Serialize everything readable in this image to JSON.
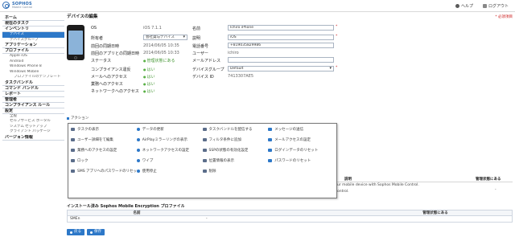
{
  "header": {
    "brand": "SOPHOS",
    "product": "Mobile Control",
    "help": "ヘルプ",
    "logout": "ログアウト"
  },
  "sidebar": {
    "items": [
      {
        "label": "ホーム",
        "kind": "group"
      },
      {
        "label": "現在のタスク",
        "kind": "group"
      },
      {
        "label": "インベントリ",
        "kind": "group"
      },
      {
        "label": "デバイス",
        "kind": "sub",
        "active": true
      },
      {
        "label": "デバイスグループ",
        "kind": "sub"
      },
      {
        "label": "アプリケーション",
        "kind": "group"
      },
      {
        "label": "プロファイル",
        "kind": "group"
      },
      {
        "label": "Apple iOS",
        "kind": "sub"
      },
      {
        "label": "Android",
        "kind": "sub"
      },
      {
        "label": "Windows Phone 8",
        "kind": "sub"
      },
      {
        "label": "Windows Mobile",
        "kind": "sub"
      },
      {
        "label": "プロファイルのテンプレート",
        "kind": "sub2"
      },
      {
        "label": "タスクバンドル",
        "kind": "group"
      },
      {
        "label": "コマンド バンドル",
        "kind": "group"
      },
      {
        "label": "レポート",
        "kind": "group"
      },
      {
        "label": "管理者",
        "kind": "group"
      },
      {
        "label": "コンプライアンス ルール",
        "kind": "group"
      },
      {
        "label": "設定",
        "kind": "group"
      },
      {
        "label": "全般",
        "kind": "sub"
      },
      {
        "label": "セルフサービス ポータル",
        "kind": "sub"
      },
      {
        "label": "システム セットアップ",
        "kind": "sub"
      },
      {
        "label": "クライアント パッケージ",
        "kind": "sub"
      },
      {
        "label": "バージョン情報",
        "kind": "group"
      }
    ]
  },
  "page": {
    "title": "デバイスの編集",
    "required_note": "* 必須項目"
  },
  "form": {
    "os_label": "OS",
    "os_value": "iOS 7.1.1",
    "owner_label": "所有者",
    "owner_value": "会社貸与デバイス",
    "last_sync_label": "前回の同期日時",
    "last_sync_value": "2014/06/05 10:35",
    "last_app_sync_label": "前回のアプリとの同期日時",
    "last_app_sync_value": "2014/06/05 10:33",
    "status_label": "ステータス",
    "status_value": "管理状態にある",
    "compliance_label": "コンプライアンス違反",
    "compliance_value": "はい",
    "mail_access_label": "メールへのアクセス",
    "mail_access_value": "はい",
    "corp_access_label": "業務へのアクセス",
    "corp_access_value": "はい",
    "network_access_label": "ネットワークへのアクセス",
    "network_access_value": "はい",
    "name_label": "名前",
    "name_value": "Ichiro iPhone",
    "desc_label": "説明",
    "desc_value": "iOS",
    "phone_label": "電話番号",
    "phone_value": "+819035829986",
    "user_label": "ユーザー",
    "user_value": "ichiro",
    "email_label": "メールアドレス",
    "email_value": "",
    "group_label": "デバイスグループ",
    "group_value": "Default",
    "device_id_label": "デバイス ID",
    "device_id_value": "7413307AE5"
  },
  "actions": {
    "heading": "アクション",
    "items": [
      {
        "label": "タスクの表示",
        "icon": "task-icon"
      },
      {
        "label": "データの更新",
        "icon": "refresh-icon"
      },
      {
        "label": "タスクバンドルを配信する",
        "icon": "bundle-icon"
      },
      {
        "label": "メッセージの送信",
        "icon": "message-icon"
      },
      {
        "label": "ユーザー詳細をて編集",
        "icon": "edit-user-icon"
      },
      {
        "label": "AirPlayミラーリングの表示",
        "icon": "airplay-icon"
      },
      {
        "label": "フィルタ条件に追加",
        "icon": "filter-icon"
      },
      {
        "label": "メールアクセスの設定",
        "icon": "mail-icon"
      },
      {
        "label": "業務へのアクセスの設定",
        "icon": "lock-icon"
      },
      {
        "label": "ネットワークアクセスの設定",
        "icon": "network-icon"
      },
      {
        "label": "SSPの状態の有効化設定",
        "icon": "ssp-icon"
      },
      {
        "label": "ログインデータのリセット",
        "icon": "reset-icon"
      },
      {
        "label": "ロック",
        "icon": "lock-icon"
      },
      {
        "label": "ワイプ",
        "icon": "wipe-icon"
      },
      {
        "label": "位置情報の表示",
        "icon": "location-icon"
      },
      {
        "label": "パスワードのリセット",
        "icon": "password-icon"
      },
      {
        "label": "SMS アプリへのパスワードのリセット",
        "icon": "sms-icon"
      },
      {
        "label": "使用停止",
        "icon": "decommission-icon"
      },
      {
        "label": "削除",
        "icon": "delete-icon"
      }
    ]
  },
  "behind": {
    "col_desc": "説明",
    "col_managed": "管理状態にある",
    "row1_desc": "ur mobile device with Sophos Mobile Control.",
    "row1_managed": "-",
    "row2_desc": "ontrol."
  },
  "encryption": {
    "title": "インストール済み Sophos Mobile Encryption プロファイル",
    "col_name": "名前",
    "col_managed": "管理状態にある",
    "rows": [
      {
        "name": "SMEn",
        "value": "-",
        "managed": ""
      }
    ]
  },
  "buttons": {
    "back": "戻る",
    "save": "保存"
  }
}
